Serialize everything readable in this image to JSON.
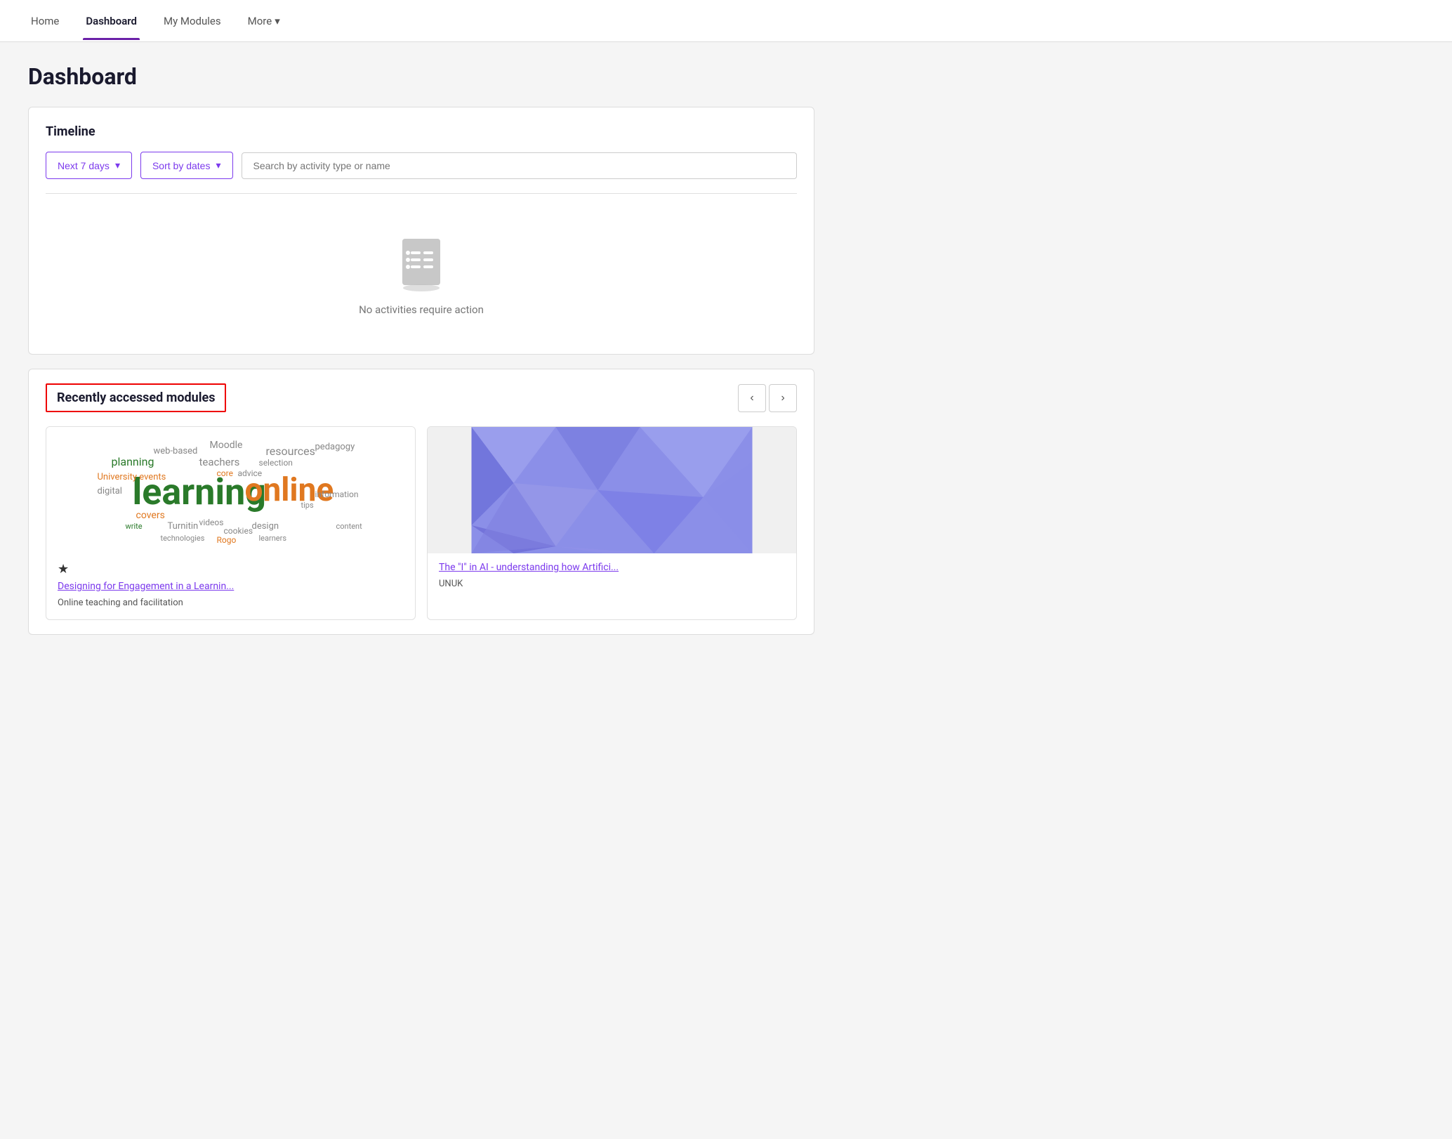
{
  "nav": {
    "items": [
      {
        "label": "Home",
        "active": false
      },
      {
        "label": "Dashboard",
        "active": true
      },
      {
        "label": "My Modules",
        "active": false
      },
      {
        "label": "More",
        "active": false,
        "hasChevron": true
      }
    ]
  },
  "page": {
    "title": "Dashboard"
  },
  "timeline": {
    "card_title": "Timeline",
    "filter_label": "Next 7 days",
    "sort_label": "Sort by dates",
    "search_placeholder": "Search by activity type or name",
    "empty_text": "No activities require action"
  },
  "recently_accessed": {
    "title": "Recently accessed modules",
    "modules": [
      {
        "type": "wordcloud",
        "starred": true,
        "link": "Designing for Engagement in a Learnin...",
        "subtitle": "Online teaching and facilitation"
      },
      {
        "type": "polygon",
        "starred": false,
        "link": "The \"I\" in AI - understanding how Artifici...",
        "subtitle": "UNUK"
      }
    ]
  },
  "icons": {
    "chevron_down": "▾",
    "chevron_left": "‹",
    "chevron_right": "›",
    "star": "★"
  }
}
